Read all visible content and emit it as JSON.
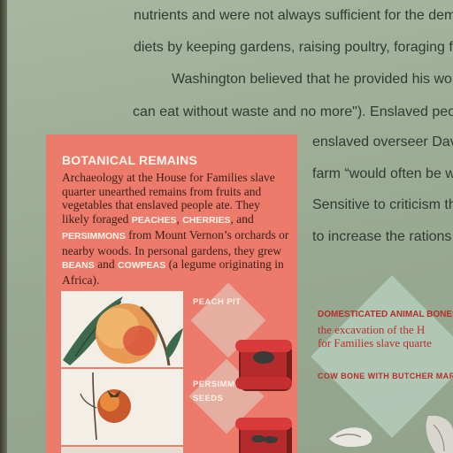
{
  "background_text": [
    "nutrients and were not always sufficient for the deman",
    "diets by keeping gardens, raising poultry, foraging for",
    "Washington believed that he provided his work",
    "can eat without waste and no more\"). Enslaved peopl",
    "enslaved overseer Davy",
    "farm “would often be w",
    "Sensitive to criticism th",
    "to increase the rations s"
  ],
  "box": {
    "title": "BOTANICAL REMAINS",
    "text_parts": [
      "Archaeology at the House for Families slave quarter unearthed remains from fruits and vegetables that enslaved people ate. They likely foraged ",
      "PEACHES",
      ", ",
      "CHERRIES",
      ", and ",
      "PERSIMMONS",
      " from Mount Vernon’s orchards or nearby woods. In personal gardens, they grew ",
      "BEANS",
      " and ",
      "COWPEAS",
      " (a legume originating in Africa)."
    ],
    "tag_peach": "PEACH PIT",
    "tag_persimmon_1": "PERSIMMO",
    "tag_persimmon_2": "SEEDS"
  },
  "animal": {
    "title": "DOMESTICATED ANIMAL BONES",
    "line1": "the excavation of the H",
    "line2": "for Families slave quarte",
    "cow_tag": "COW BONE WITH BUTCHER MAR"
  },
  "colors": {
    "panel": "#9fae95",
    "box": "#ec7b6c",
    "accent_red": "#b3302b"
  }
}
